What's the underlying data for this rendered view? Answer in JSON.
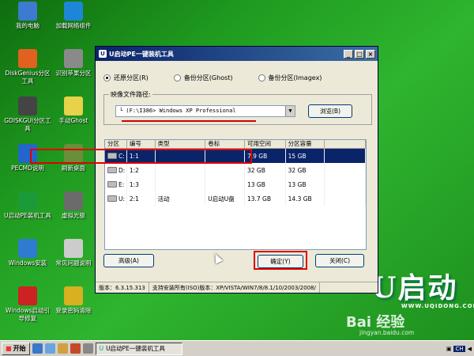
{
  "desktop_icons": [
    {
      "label": "我的电脑",
      "icon": "my-computer-icon",
      "color": "#3d7ad0"
    },
    {
      "label": "加载网络组件",
      "icon": "network-globe-icon",
      "color": "#1e86d6"
    },
    {
      "label": "DiskGenius分区工具",
      "icon": "diskgenius-icon",
      "color": "#e0621e"
    },
    {
      "label": "识别苹果分区",
      "icon": "apple-partition-icon",
      "color": "#8a8a8a"
    },
    {
      "label": "GDISKGUI分区工具",
      "icon": "gdisk-icon",
      "color": "#444444"
    },
    {
      "label": "手动Ghost",
      "icon": "ghost-icon",
      "color": "#e8d24a"
    },
    {
      "label": "PECMD说明",
      "icon": "help-icon",
      "color": "#2266cc"
    },
    {
      "label": "刷新桌面",
      "icon": "refresh-desktop-icon",
      "color": "#6a8e3a"
    },
    {
      "label": "U启动PE装机工具",
      "icon": "u-qidong-icon",
      "color": "#1b9a3a"
    },
    {
      "label": "虚拟光驱",
      "icon": "virtual-drive-icon",
      "color": "#6b6b6b"
    },
    {
      "label": "Windows安装",
      "icon": "windows-install-icon",
      "color": "#2f7bd0"
    },
    {
      "label": "常见问题说明",
      "icon": "faq-doc-icon",
      "color": "#cccccc"
    },
    {
      "label": "Windows启动引导修复",
      "icon": "boot-repair-icon",
      "color": "#cc2222"
    },
    {
      "label": "登录密码清除",
      "icon": "key-icon",
      "color": "#d8b020"
    }
  ],
  "window": {
    "title": "U启动PE一键装机工具",
    "minimize": "_",
    "maximize": "□",
    "close": "×",
    "radios": [
      {
        "label": "还原分区(R)",
        "checked": true
      },
      {
        "label": "备份分区(Ghost)",
        "checked": false
      },
      {
        "label": "备份分区(Imagex)",
        "checked": false
      }
    ],
    "image_path_legend": "映像文件路径:",
    "image_path_value": "└ (F:\\I386> Windows XP Professional",
    "browse_label": "浏览(B)",
    "columns": [
      "分区",
      "编号",
      "类型",
      "卷标",
      "可用空间",
      "分区容量"
    ],
    "rows": [
      {
        "drive": "C:",
        "num": "1:1",
        "type": "",
        "label": "",
        "free": "7.9 GB",
        "size": "15 GB",
        "selected": true
      },
      {
        "drive": "D:",
        "num": "1:2",
        "type": "",
        "label": "",
        "free": "32 GB",
        "size": "32 GB",
        "selected": false
      },
      {
        "drive": "E:",
        "num": "1:3",
        "type": "",
        "label": "",
        "free": "13 GB",
        "size": "13 GB",
        "selected": false
      },
      {
        "drive": "U:",
        "num": "2:1",
        "type": "活动",
        "label": "U启动U盘",
        "free": "13.7 GB",
        "size": "14.3 GB",
        "selected": false
      }
    ],
    "advanced_label": "高级(A)",
    "ok_label": "确定(Y)",
    "close_label": "关闭(C)",
    "status_version": "版本：6.3.15.313",
    "status_support": "支持安装所有(ISO)版本：XP/VISTA/WIN7/8/8.1/10/2003/2008/"
  },
  "brand": {
    "text": "U启动",
    "url": "WWW.UQIDONG.COM"
  },
  "watermark": {
    "text": "Bai 经验",
    "url": "jingyan.baidu.com"
  },
  "taskbar": {
    "start": "开始",
    "task_item": "U启动PE一键装机工具",
    "ime": "CH"
  }
}
